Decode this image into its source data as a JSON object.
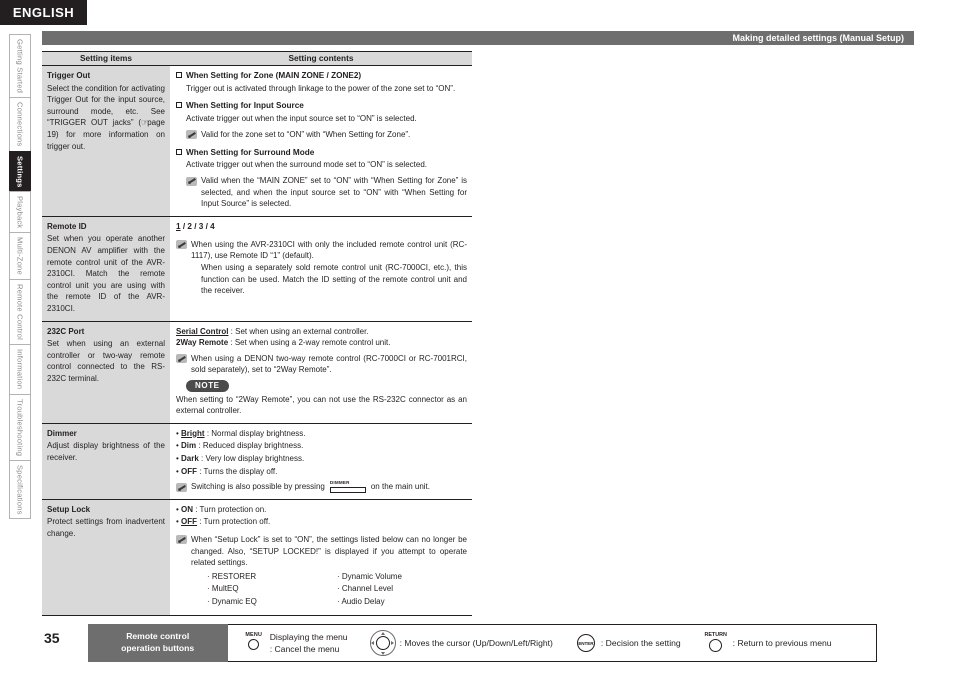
{
  "banner": {
    "language": "ENGLISH"
  },
  "section_header": {
    "title": "Making detailed settings (Manual Setup)"
  },
  "side_tabs": [
    {
      "label": "Getting Started",
      "active": false
    },
    {
      "label": "Connections",
      "active": false
    },
    {
      "label": "Settings",
      "active": true
    },
    {
      "label": "Playback",
      "active": false
    },
    {
      "label": "Multi-Zone",
      "active": false
    },
    {
      "label": "Remote Control",
      "active": false
    },
    {
      "label": "Information",
      "active": false
    },
    {
      "label": "Troubleshooting",
      "active": false
    },
    {
      "label": "Specifications",
      "active": false
    }
  ],
  "table": {
    "headers": {
      "left": "Setting items",
      "right": "Setting contents"
    },
    "rows": {
      "trigger_out": {
        "title": "Trigger Out",
        "desc_1": "Select the condition for activating Trigger Out for the input source, surround mode, etc.",
        "desc_2_pre": "See “TRIGGER OUT jacks” (",
        "desc_2_icon": "hand-pointer-icon",
        "desc_2_mid": "page 19) for more information on trigger out.",
        "opt1_head": "When Setting for Zone (MAIN ZONE / ZONE2)",
        "opt1_body": "Trigger out is activated through linkage to the power of the zone set to “ON”.",
        "opt2_head": "When Setting for Input Source",
        "opt2_body": "Activate trigger out when the input source set to “ON” is selected.",
        "opt2_note": "Valid for the zone set to “ON” with “When Setting for Zone”.",
        "opt3_head": "When Setting for Surround Mode",
        "opt3_body": "Activate trigger out when the surround mode set to “ON” is selected.",
        "opt3_note": "Valid when the “MAIN ZONE” set to “ON” with “When Setting for Zone” is selected, and when the input source set to “ON” with “When Setting for Input Source” is selected."
      },
      "remote_id": {
        "title": "Remote ID",
        "desc": "Set when you operate another DENON AV amplifier with the remote control unit of the AVR-2310CI. Match the remote control unit you are using with the remote ID of the AVR-2310CI.",
        "values_default": "1",
        "values_rest": " / 2 / 3 / 4",
        "note_1": "When using the AVR-2310CI with only the included remote control unit (RC-1117), use Remote ID “1” (default).",
        "note_2": "When using a separately sold remote control unit (RC-7000CI, etc.), this function can be used. Match the ID setting of the remote control unit and the receiver."
      },
      "port_232c": {
        "title": "232C Port",
        "desc": "Set when using an external controller or two-way remote control connected to the RS-232C terminal.",
        "opt1_label": "Serial Control",
        "opt1_text": " : Set when using an external controller.",
        "opt2_label": "2Way Remote",
        "opt2_text": " : Set when using a 2-way remote control unit.",
        "note": "When using a DENON two-way remote control (RC-7000CI or RC-7001RCI, sold separately), set to “2Way Remote”.",
        "note_badge": "NOTE",
        "note_body": "When setting to “2Way Remote”, you can not use the RS-232C connector as an external controller."
      },
      "dimmer": {
        "title": "Dimmer",
        "desc": "Adjust display brightness of the receiver.",
        "options": [
          {
            "label": "Bright",
            "text": " : Normal display brightness.",
            "default": true
          },
          {
            "label": "Dim",
            "text": " : Reduced display brightness.",
            "default": false
          },
          {
            "label": "Dark",
            "text": " : Very low display brightness.",
            "default": false
          },
          {
            "label": "OFF",
            "text": " : Turns the display off.",
            "default": false
          }
        ],
        "note_pre": "Switching is also possible by pressing",
        "note_key": "DIMMER",
        "note_post": "on the main unit."
      },
      "setup_lock": {
        "title": "Setup Lock",
        "desc": "Protect settings from inadvertent change.",
        "options": [
          {
            "label": "ON",
            "text": " : Turn protection on.",
            "default": false
          },
          {
            "label": "OFF",
            "text": " : Turn protection off.",
            "default": true
          }
        ],
        "note": "When “Setup Lock” is set to “ON”, the settings listed below can no longer be changed. Also, “SETUP LOCKED!” is displayed if you attempt to operate related settings.",
        "sublist_left": [
          "· RESTORER",
          "· MultEQ",
          "· Dynamic EQ"
        ],
        "sublist_right": [
          "· Dynamic Volume",
          "· Channel Level",
          "· Audio Delay"
        ]
      }
    }
  },
  "footer": {
    "page_number": "35",
    "label_line1": "Remote control",
    "label_line2": "operation buttons",
    "items": [
      {
        "key_label": "MENU",
        "icon": "menu-circle-icon",
        "text_line1": "Displaying the menu",
        "text_line2": ": Cancel the menu"
      },
      {
        "key_label": "",
        "icon": "cursor-pad-icon",
        "text_line1": ": Moves the cursor (Up/Down/Left/Right)",
        "text_line2": ""
      },
      {
        "key_label": "ENTER",
        "icon": "enter-circle-icon",
        "text_line1": ": Decision the setting",
        "text_line2": ""
      },
      {
        "key_label": "RETURN",
        "icon": "return-circle-icon",
        "text_line1": ": Return to previous menu",
        "text_line2": ""
      }
    ]
  },
  "colors": {
    "ink": "#231f20",
    "header_bar": "#6e6e6e",
    "table_head_bg": "#d9d9d9",
    "cell_left_bg": "#d9d9d9",
    "note_badge_bg": "#4b4b4b"
  }
}
